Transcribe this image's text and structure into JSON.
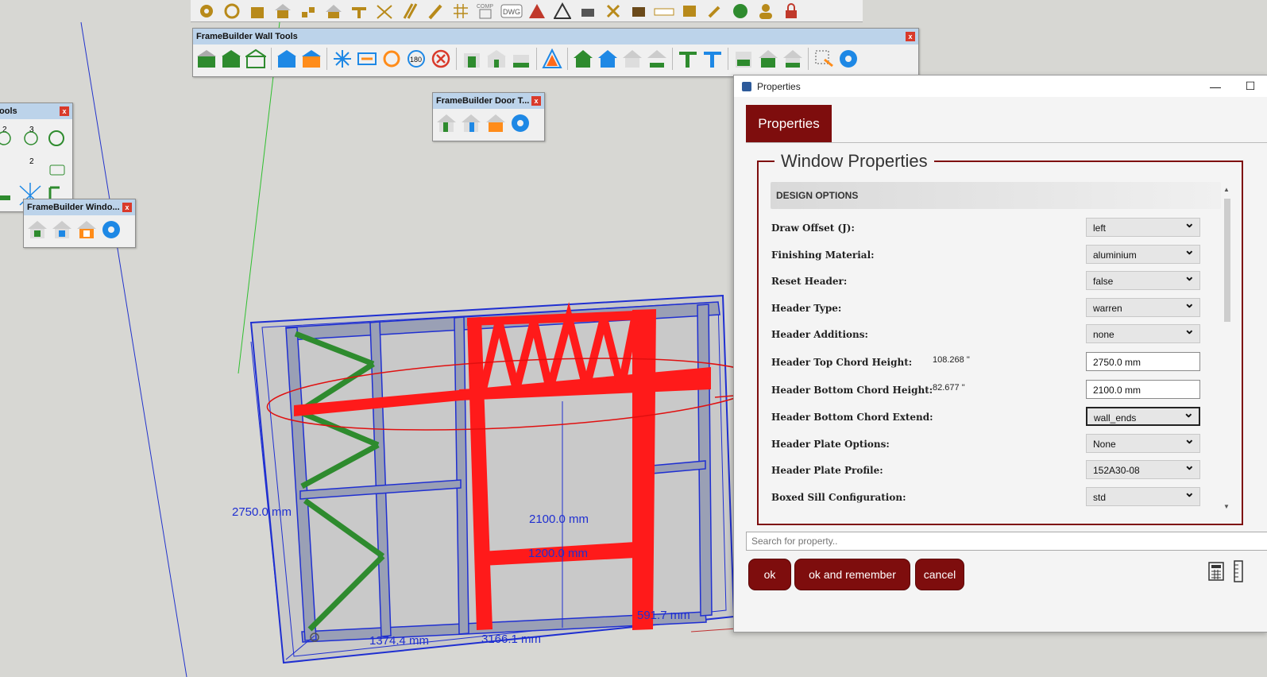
{
  "toolbars": {
    "wall_tools": {
      "title": "FrameBuilder Wall Tools",
      "close": "x"
    },
    "door_tools": {
      "title": "FrameBuilder Door T...",
      "close": "x"
    },
    "window_tools": {
      "title": "FrameBuilder Windo...",
      "close": "x"
    },
    "left_tools": {
      "title": "ools",
      "close": "x"
    }
  },
  "top_strip": {
    "comp_label": "COMP",
    "dwg_label": "DWG"
  },
  "wall_icon_labels": {
    "rotate180": "180"
  },
  "left_tool_labels": {
    "a": "2",
    "b": "3",
    "c": "2"
  },
  "dimensions": {
    "height_left": "2750.0 mm",
    "opening_height": "2100.0 mm",
    "opening_width": "1200.0 mm",
    "bottom_left": "1374.4 mm",
    "bottom_mid": "3166.1 mm",
    "bottom_right": "591.7 mm"
  },
  "properties_window": {
    "title": "Properties",
    "controls": {
      "minimize": "—",
      "maximize": "☐"
    },
    "tab_label": "Properties",
    "fieldset_legend": "Window Properties",
    "section_title": "DESIGN OPTIONS",
    "rows": [
      {
        "label": "Draw Offset (J):",
        "value": "left",
        "type": "select"
      },
      {
        "label": "Finishing Material:",
        "value": "aluminium",
        "type": "select"
      },
      {
        "label": "Reset Header:",
        "value": "false",
        "type": "select"
      },
      {
        "label": "Header Type:",
        "value": "warren",
        "type": "select"
      },
      {
        "label": "Header Additions:",
        "value": "none",
        "type": "select"
      },
      {
        "label": "Header Top Chord Height:",
        "aux": "108.268 \"",
        "value": "2750.0 mm",
        "type": "input"
      },
      {
        "label": "Header Bottom Chord Height:",
        "aux": "82.677 \"",
        "value": "2100.0 mm",
        "type": "input"
      },
      {
        "label": "Header Bottom Chord Extend:",
        "value": "wall_ends",
        "type": "select"
      },
      {
        "label": "Header Plate Options:",
        "value": "None",
        "type": "select"
      },
      {
        "label": "Header Plate Profile:",
        "value": "152A30-08",
        "type": "select"
      },
      {
        "label": "Boxed Sill Configuration:",
        "value": "std",
        "type": "select"
      }
    ],
    "search_placeholder": "Search for property..",
    "buttons": {
      "ok": "ok",
      "ok_remember": "ok and remember",
      "cancel": "cancel"
    }
  },
  "colors": {
    "accent": "#7e0d0d",
    "wire": "#1f2fd1",
    "highlight": "#ff1a1a",
    "brace": "#2e8b2e"
  }
}
